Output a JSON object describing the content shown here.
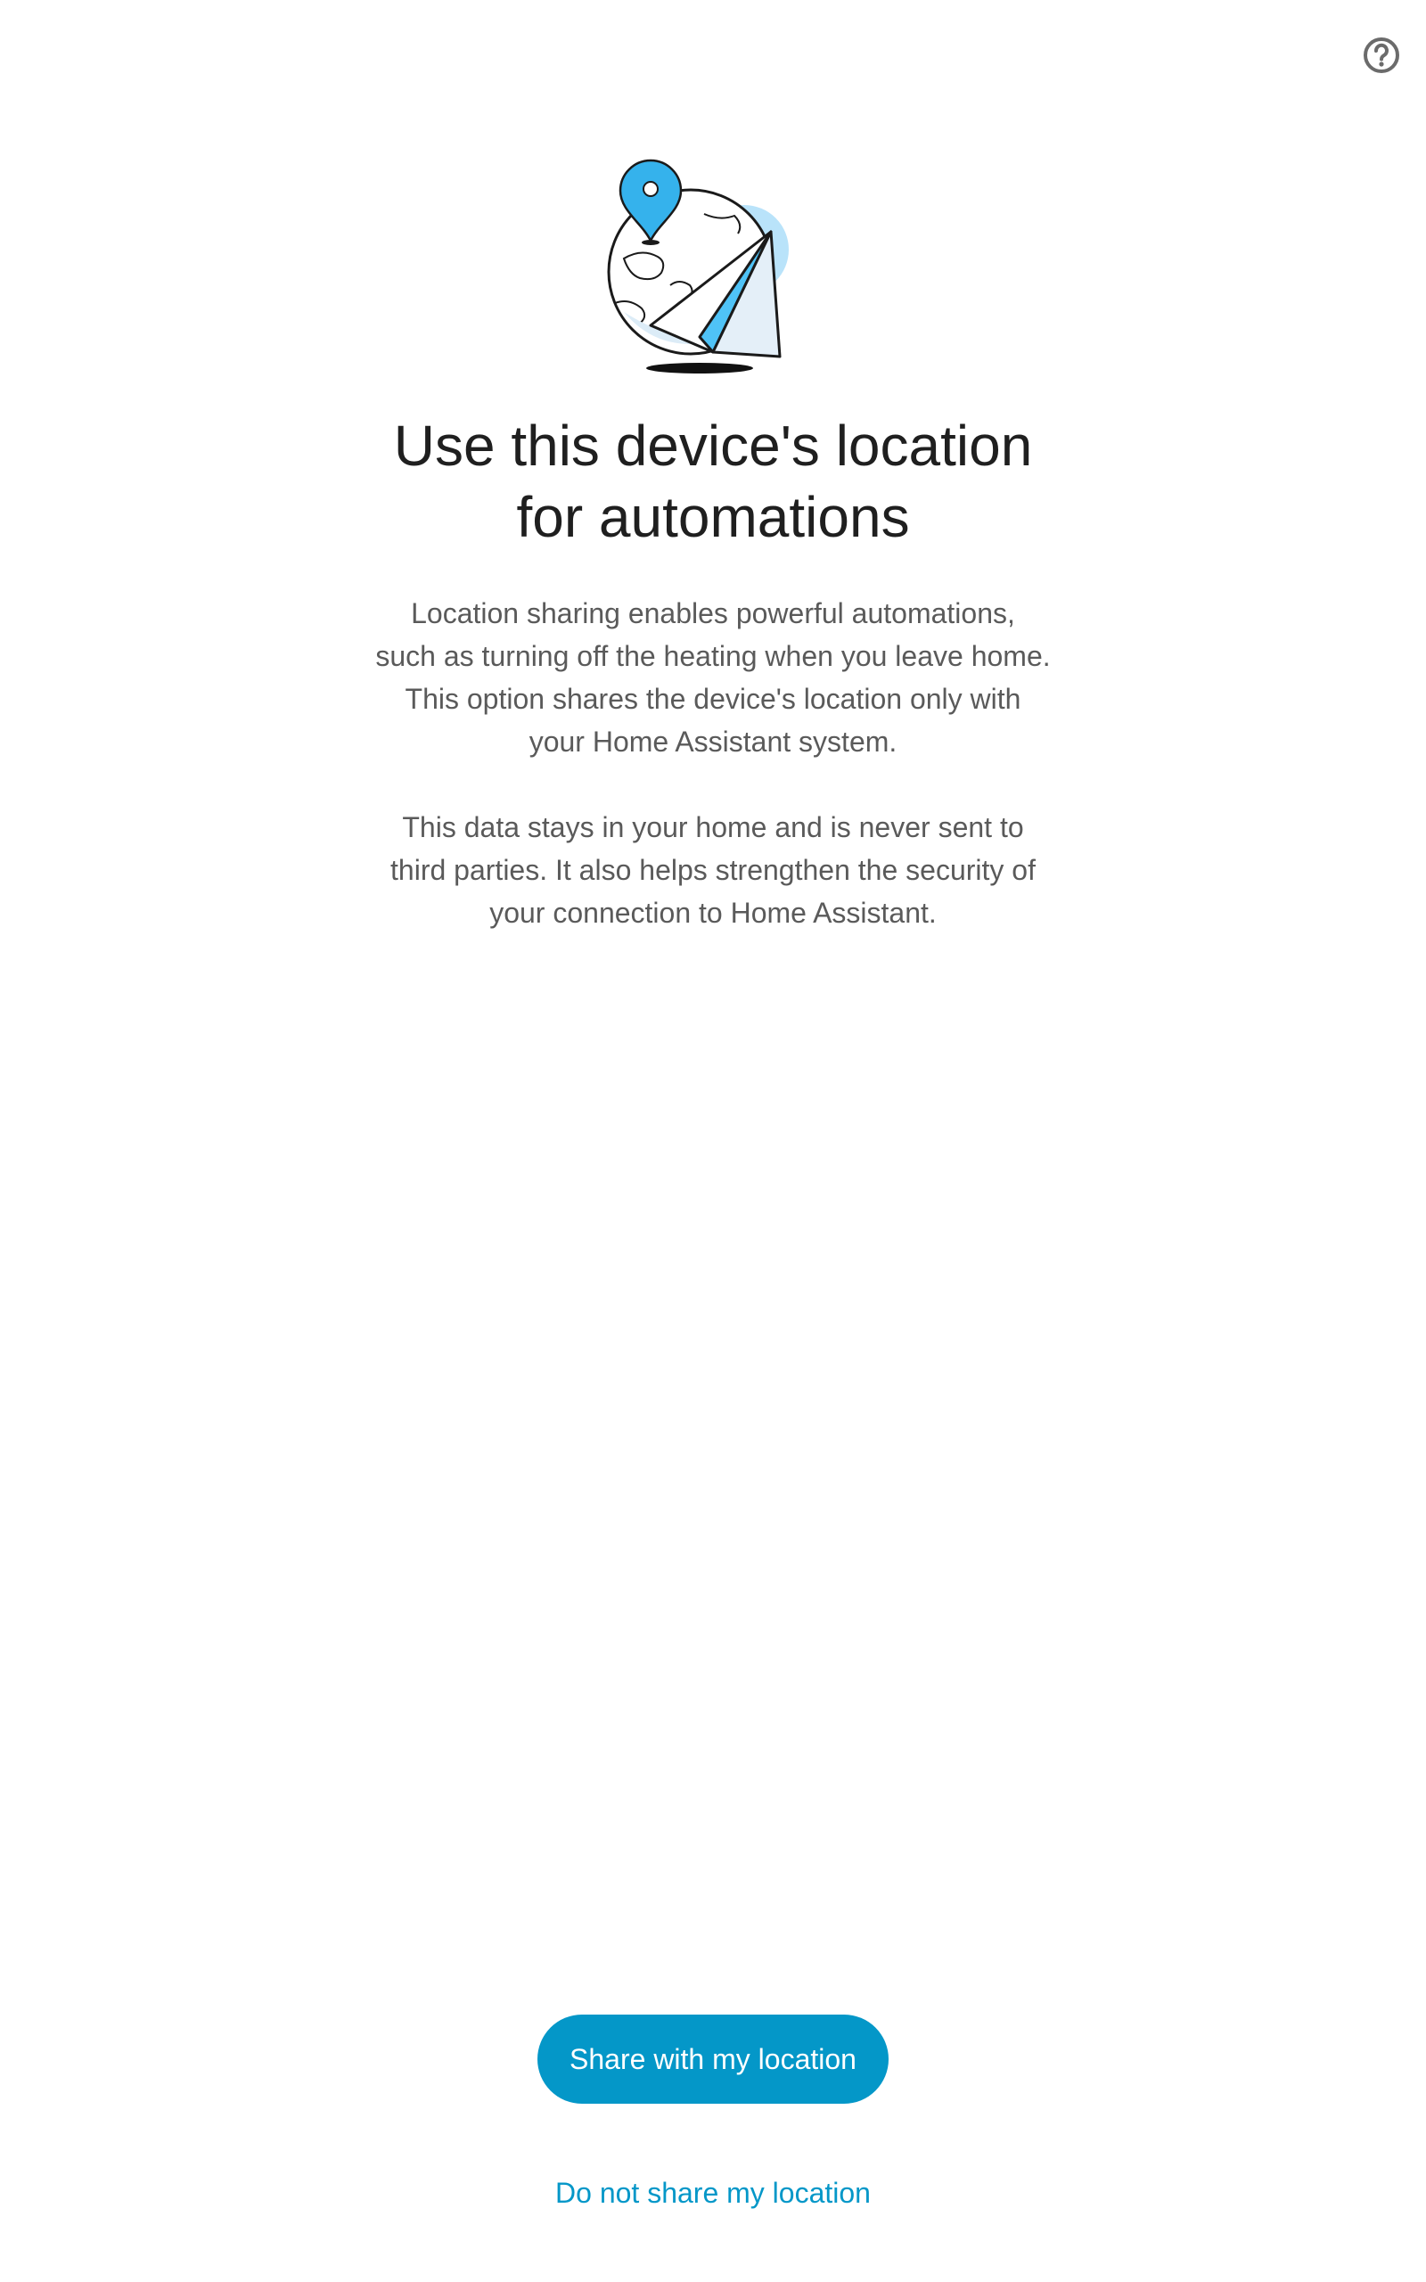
{
  "header": {
    "help_icon": "help-circle-icon"
  },
  "illustration": {
    "icon": "globe-location-paper-plane-illustration",
    "accent_color": "#4fc3f7"
  },
  "main": {
    "title_lines": [
      "Use this device's location",
      "for automations"
    ],
    "paragraph1_lines": [
      "Location sharing enables powerful automations,",
      "such as turning off the heating when you leave home.",
      "This option shares the device's location only with",
      "your Home Assistant system."
    ],
    "paragraph2_lines": [
      "This data stays in your home and is never sent to",
      "third parties. It also helps strengthen the security of",
      "your connection to Home Assistant."
    ]
  },
  "actions": {
    "share_label": "Share with my location",
    "decline_label": "Do not share my location",
    "primary_color": "#0497c8"
  }
}
